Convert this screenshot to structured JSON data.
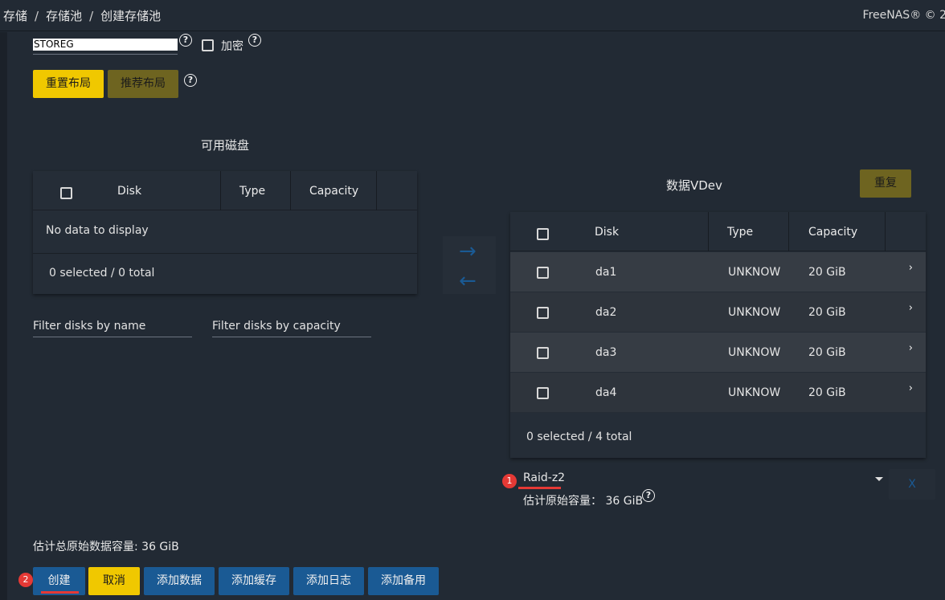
{
  "breadcrumb": {
    "items": [
      "存储",
      "存储池",
      "创建存储池"
    ],
    "separator": "/"
  },
  "brand": "FreeNAS® © 2",
  "pool": {
    "name_value": "STOREG",
    "encrypt_label": "加密"
  },
  "layout_buttons": {
    "reset": "重置布局",
    "suggest": "推荐布局"
  },
  "available": {
    "title": "可用磁盘",
    "columns": [
      "Disk",
      "Type",
      "Capacity"
    ],
    "empty_message": "No data to display",
    "footer": "0 selected / 0 total",
    "filter_name_placeholder": "Filter disks by name",
    "filter_capacity_placeholder": "Filter disks by capacity"
  },
  "transfer": {
    "right_arrow": "→",
    "left_arrow": "←"
  },
  "data_vdev": {
    "title": "数据VDev",
    "reset_button": "重复",
    "columns": [
      "Disk",
      "Type",
      "Capacity"
    ],
    "rows": [
      {
        "disk": "da1",
        "type": "UNKNOW",
        "capacity": "20 GiB"
      },
      {
        "disk": "da2",
        "type": "UNKNOW",
        "capacity": "20 GiB"
      },
      {
        "disk": "da3",
        "type": "UNKNOW",
        "capacity": "20 GiB"
      },
      {
        "disk": "da4",
        "type": "UNKNOW",
        "capacity": "20 GiB"
      }
    ],
    "footer": "0 selected / 4 total",
    "layout_value": "Raid-z2",
    "estimated_label": "估计原始容量：",
    "estimated_value": "36 GiB",
    "remove_label": "X"
  },
  "total_estimate": "估计总原始数据容量: 36 GiB",
  "actions": {
    "create": "创建",
    "cancel": "取消",
    "add_data": "添加数据",
    "add_cache": "添加缓存",
    "add_log": "添加日志",
    "add_spare": "添加备用"
  },
  "annotations": {
    "badge1": "1",
    "badge2": "2"
  },
  "colors": {
    "accent_yellow": "#f0c800",
    "olive": "#6e6420",
    "primary_blue": "#1a5a94",
    "annotation_red": "#e53935",
    "background": "#222a34"
  },
  "icons": [
    "help-icon",
    "checkbox-icon",
    "chevron-right-icon",
    "arrow-right-icon",
    "arrow-left-icon",
    "dropdown-caret-icon"
  ]
}
